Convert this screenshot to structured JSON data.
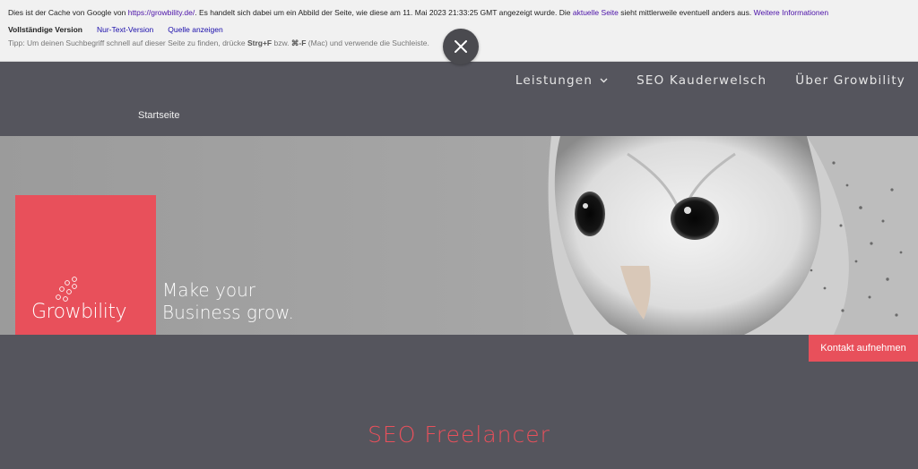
{
  "cache_bar": {
    "text_prefix": "Dies ist der Cache von Google von ",
    "source_url": "https://growbility.de/",
    "text_middle": ". Es handelt sich dabei um ein Abbild der Seite, wie diese am 11. Mai 2023 21:33:25 GMT angezeigt wurde. Die ",
    "current_page_link": "aktuelle Seite",
    "text_suffix": " sieht mittlerweile eventuell anders aus. ",
    "more_info_link": "Weitere Informationen",
    "full_version": "Vollständige Version",
    "text_only_link": "Nur-Text-Version",
    "source_link": "Quelle anzeigen",
    "tip_prefix": "Tipp: Um deinen Suchbegriff schnell auf dieser Seite zu finden, drücke ",
    "tip_key1": "Strg+F",
    "tip_mid": " bzw. ",
    "tip_key2": "⌘-F",
    "tip_suffix": " (Mac) und verwende die Suchleiste."
  },
  "nav": {
    "items": [
      {
        "label": "Leistungen"
      },
      {
        "label": "SEO Kauderwelsch"
      },
      {
        "label": "Über Growbility"
      }
    ]
  },
  "breadcrumb": "Startseite",
  "hero": {
    "logo_text": "Growbility",
    "tagline_line1": "Make your",
    "tagline_line2": "Business grow."
  },
  "contact_button": "Kontakt aufnehmen",
  "section_title": "SEO Freelancer",
  "colors": {
    "accent": "#e8505b",
    "header_bg": "#55555d",
    "cache_bg": "#f1f1f1"
  }
}
